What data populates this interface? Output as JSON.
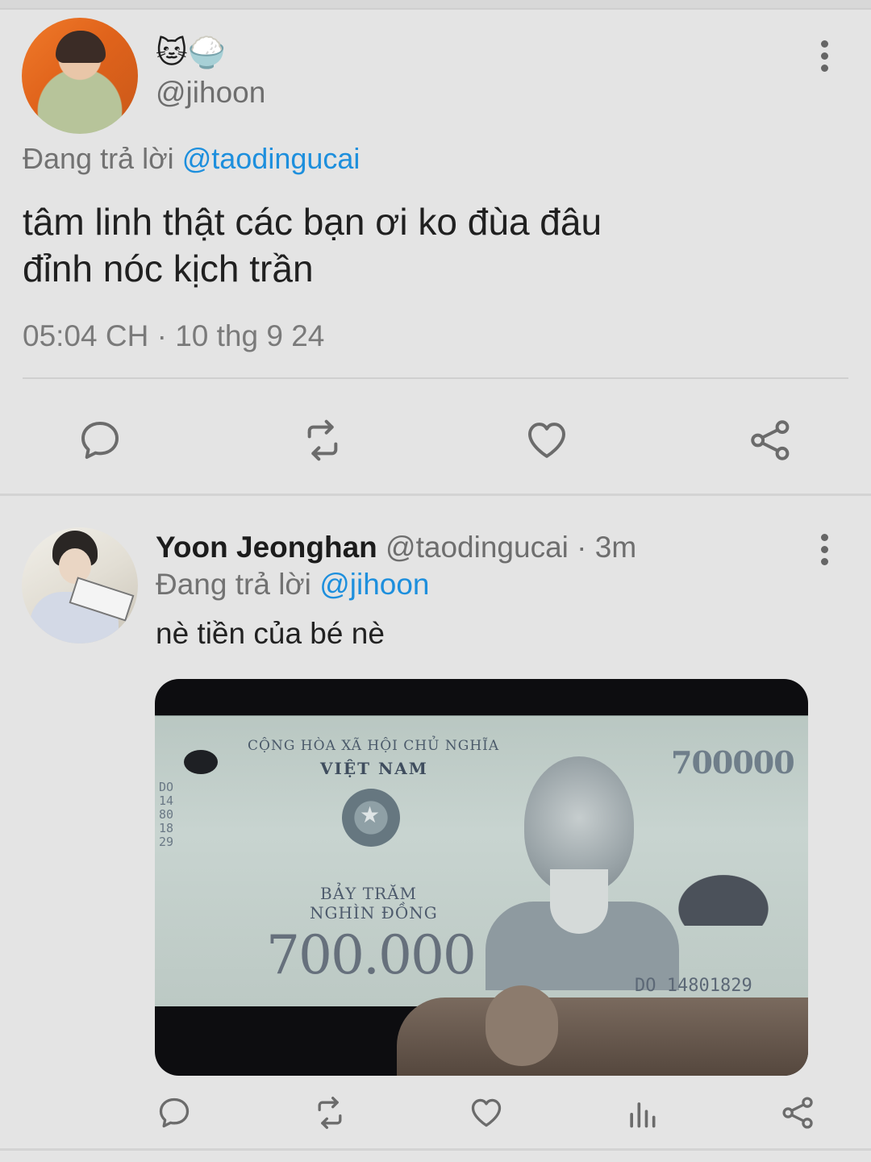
{
  "main_tweet": {
    "emojis": "🐱🍚",
    "handle": "@jihoon",
    "reply_prefix": "Đang trả lời",
    "reply_to": "@taodingucai",
    "text_line1": "tâm linh thật các bạn ơi ko đùa đâu",
    "text_line2": "đỉnh nóc kịch trần",
    "timestamp": "05:04 CH · 10 thg 9 24",
    "actions": [
      "reply-icon",
      "retweet-icon",
      "like-icon",
      "share-icon"
    ]
  },
  "reply_tweet": {
    "name": "Yoon Jeonghan",
    "handle": "@taodingucai",
    "time": "· 3m",
    "reply_prefix": "Đang trả lời",
    "reply_to": "@jihoon",
    "text": "nè tiền của bé nè",
    "actions": [
      "reply-icon",
      "retweet-icon",
      "like-icon",
      "views-icon",
      "share-icon"
    ]
  },
  "banknote": {
    "country_line1": "CỘNG HÒA XÃ HỘI CHỦ NGHĨA",
    "country_line2": "VIỆT NAM",
    "denomination_top": "700000",
    "words_line1": "BẢY TRĂM",
    "words_line2": "NGHÌN ĐỒNG",
    "denomination_big": "700.000",
    "serial_side": "DO 14801829",
    "serial_bottom": "DO 14801829"
  },
  "colors": {
    "background": "#e4e4e4",
    "mention": "#1d8fdd",
    "icon": "#6b6b6b"
  }
}
